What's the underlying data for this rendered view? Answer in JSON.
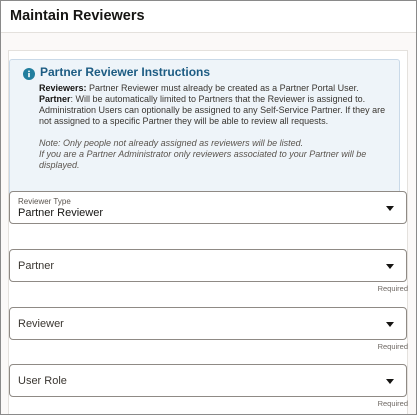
{
  "header": {
    "title": "Maintain Reviewers"
  },
  "instructions": {
    "icon": "info-icon",
    "title": "Partner Reviewer Instructions",
    "reviewers_label": "Reviewers:",
    "reviewers_text": " Partner Reviewer must already be created as a Partner Portal User.",
    "partner_label": "Partner",
    "partner_text": ": Will be automatically limited to Partners that the Reviewer is assigned to. Administration Users can optionally be assigned to any Self-Service Partner. If they are not assigned to a specific Partner they will be able to review all requests.",
    "note_line1": "Note: Only people not already assigned as reviewers will be listed.",
    "note_line2": "If you are a Partner Administrator only reviewers associated to your Partner will be displayed."
  },
  "fields": {
    "reviewer_type": {
      "label": "Reviewer Type",
      "value": "Partner Reviewer"
    },
    "partner": {
      "label": "Partner",
      "required": "Required"
    },
    "reviewer": {
      "label": "Reviewer",
      "required": "Required"
    },
    "user_role": {
      "label": "User Role",
      "required": "Required"
    }
  },
  "colors": {
    "accent": "#1d5c83",
    "info_background": "#eef4f9",
    "info_icon": "#227e9e"
  }
}
